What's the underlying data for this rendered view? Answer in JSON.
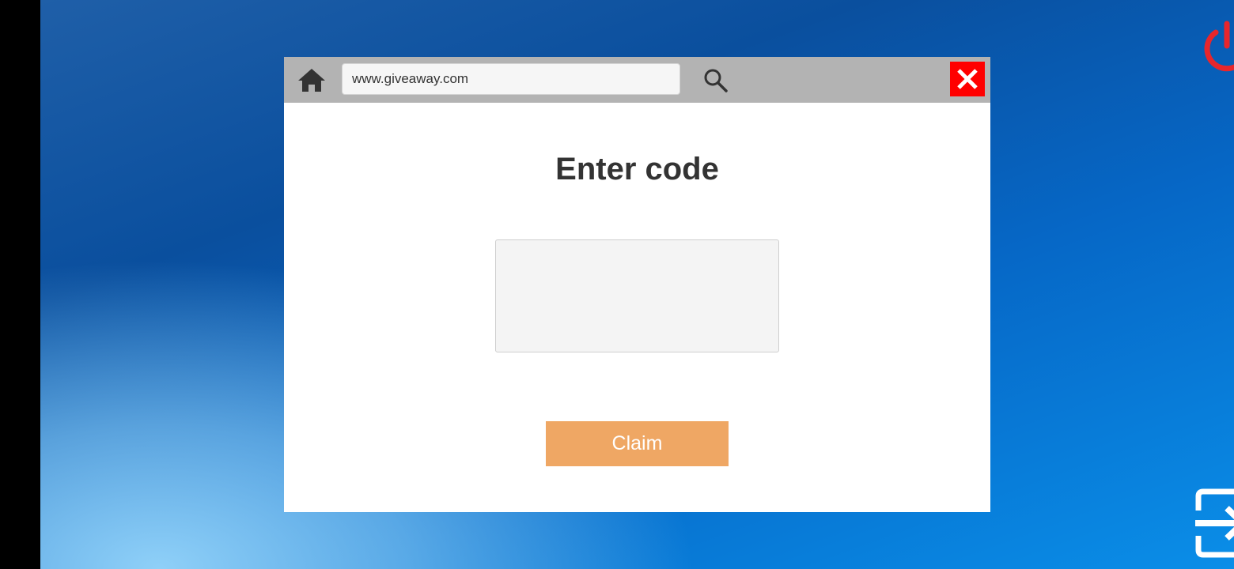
{
  "browser": {
    "url": "www.giveaway.com"
  },
  "page": {
    "title": "Enter code",
    "code_input_value": "",
    "claim_label": "Claim"
  },
  "icons": {
    "home": "home-icon",
    "search": "search-icon",
    "close": "close-icon",
    "power": "power-icon",
    "exit": "exit-icon"
  },
  "colors": {
    "close_button": "#ff0000",
    "claim_button": "#efa764",
    "power_icon": "#e8262c",
    "toolbar": "#b3b3b3"
  }
}
